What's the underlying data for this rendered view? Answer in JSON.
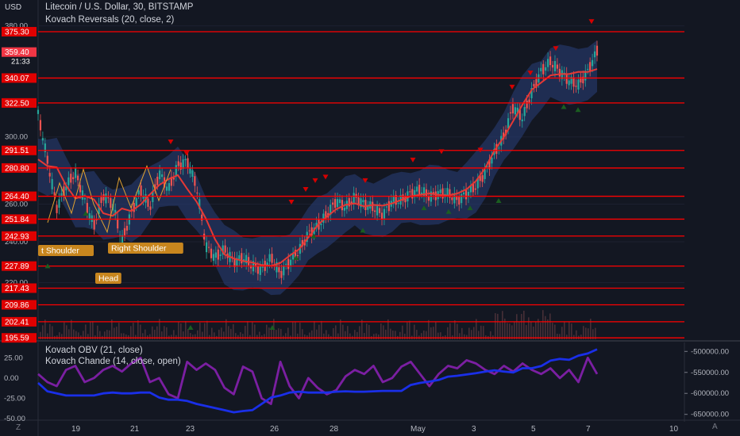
{
  "header": {
    "title": "Litecoin / U.S. Dollar, 30, BITSTAMP",
    "indicator_1": "Kovach Reversals (20, close, 2)",
    "indicator_2": "Kovach OBV (21, close)",
    "indicator_3": "Kovach Chande (14, close, open)",
    "currency": "USD",
    "price_badge": "359.40",
    "countdown": "21:33",
    "logo_text": "Z",
    "tv_logo": "A"
  },
  "colors": {
    "background": "#131722",
    "level_line": "#ff0000",
    "candle_up": "#26a69a",
    "candle_down": "#ef5350",
    "band": "#1e3a8a",
    "band_fill": "#2a3f7a",
    "ma_line": "#e53935",
    "label_bg": "#c8861e",
    "obv_line": "#1a2fe8",
    "chande_line": "#7b1fa2",
    "marker_down": "#d50000",
    "marker_up": "#1b5e20",
    "pattern_line": "#e0a030"
  },
  "chart_data": [
    {
      "type": "line",
      "symbol": "Litecoin / U.S. Dollar, 30, BITSTAMP",
      "x_ticks": [
        "19",
        "21",
        "23",
        "26",
        "28",
        "May",
        "3",
        "5",
        "7",
        "10"
      ],
      "y_ticks": [
        "380.00",
        "300.00",
        "260.00",
        "240.00",
        "220.00"
      ],
      "ylim": [
        195,
        383
      ],
      "scale": "log",
      "price_levels": [
        "375.30",
        "359.40",
        "340.07",
        "322.50",
        "291.51",
        "280.80",
        "264.40",
        "251.84",
        "242.93",
        "227.89",
        "217.43",
        "209.86",
        "202.41",
        "195.59"
      ],
      "support_resistance": [
        375.3,
        340.07,
        322.5,
        291.51,
        280.8,
        264.4,
        251.84,
        242.93,
        227.89,
        217.43,
        209.86,
        202.41,
        195.59
      ],
      "last_price": 359.4,
      "annotations": [
        "t Shoulder",
        "Right Shoulder",
        "Head"
      ],
      "series": [
        {
          "name": "Litecoin / U.S. Dollar",
          "x": [
            0,
            1,
            2,
            3,
            4,
            5,
            6,
            7,
            8,
            9,
            10,
            11,
            12,
            13,
            14,
            15,
            16,
            17,
            18,
            19,
            20,
            21,
            22,
            23,
            24,
            25,
            26,
            27,
            28,
            29,
            30,
            31,
            32,
            33,
            34,
            35,
            36,
            37,
            38,
            39,
            40,
            41,
            42,
            43,
            44,
            45,
            46,
            47,
            48,
            49,
            50,
            51,
            52,
            53,
            54,
            55,
            56,
            57,
            58,
            59,
            60
          ],
          "values": [
            315,
            285,
            258,
            270,
            278,
            262,
            248,
            265,
            260,
            240,
            255,
            268,
            258,
            278,
            268,
            282,
            285,
            270,
            238,
            232,
            236,
            230,
            232,
            228,
            226,
            232,
            224,
            230,
            235,
            244,
            248,
            254,
            262,
            258,
            264,
            260,
            258,
            254,
            262,
            262,
            266,
            268,
            264,
            266,
            266,
            262,
            266,
            270,
            278,
            290,
            300,
            320,
            312,
            330,
            345,
            352,
            345,
            338,
            335,
            345,
            360
          ]
        }
      ]
    },
    {
      "type": "line",
      "title": "Kovach OBV (21, close)",
      "y_ticks": [
        "-500000.00",
        "-550000.00",
        "-600000.00",
        "-650000.00"
      ],
      "ylim": [
        -660000,
        -490000
      ],
      "series": [
        {
          "name": "Kovach OBV (21, close)",
          "x": [
            0,
            1,
            2,
            3,
            4,
            5,
            6,
            7,
            8,
            9,
            10,
            11,
            12,
            13,
            14,
            15,
            16,
            17,
            18,
            19,
            20,
            21,
            22,
            23,
            24,
            25,
            26,
            27,
            28,
            29,
            30,
            31,
            32,
            33,
            34,
            35,
            36,
            37,
            38,
            39,
            40,
            41,
            42,
            43,
            44,
            45,
            46,
            47,
            48,
            49,
            50,
            51,
            52,
            53,
            54,
            55,
            56,
            57,
            58,
            59,
            60
          ],
          "values": [
            -575000,
            -595000,
            -600000,
            -605000,
            -605000,
            -605000,
            -605000,
            -600000,
            -598000,
            -600000,
            -600000,
            -598000,
            -598000,
            -610000,
            -615000,
            -615000,
            -618000,
            -625000,
            -630000,
            -635000,
            -640000,
            -645000,
            -642000,
            -640000,
            -625000,
            -610000,
            -605000,
            -598000,
            -596000,
            -598000,
            -598000,
            -598000,
            -596000,
            -595000,
            -596000,
            -596000,
            -595000,
            -594000,
            -594000,
            -594000,
            -580000,
            -575000,
            -572000,
            -568000,
            -560000,
            -558000,
            -555000,
            -552000,
            -548000,
            -545000,
            -548000,
            -550000,
            -540000,
            -540000,
            -535000,
            -522000,
            -518000,
            -520000,
            -510000,
            -505000,
            -495000
          ]
        }
      ]
    },
    {
      "type": "line",
      "title": "Kovach Chande (14, close, open)",
      "y_ticks": [
        "25.00",
        "0.00",
        "-25.00",
        "-50.00"
      ],
      "ylim": [
        -50,
        38
      ],
      "series": [
        {
          "name": "Kovach Chande (14, close, open)",
          "x": [
            0,
            1,
            2,
            3,
            4,
            5,
            6,
            7,
            8,
            9,
            10,
            11,
            12,
            13,
            14,
            15,
            16,
            17,
            18,
            19,
            20,
            21,
            22,
            23,
            24,
            25,
            26,
            27,
            28,
            29,
            30,
            31,
            32,
            33,
            34,
            35,
            36,
            37,
            38,
            39,
            40,
            41,
            42,
            43,
            44,
            45,
            46,
            47,
            48,
            49,
            50,
            51,
            52,
            53,
            54,
            55,
            56,
            57,
            58,
            59,
            60
          ],
          "values": [
            5,
            -5,
            -10,
            10,
            15,
            -5,
            0,
            10,
            15,
            8,
            18,
            25,
            -5,
            0,
            -20,
            -25,
            20,
            10,
            18,
            10,
            -12,
            -20,
            14,
            8,
            -25,
            -32,
            20,
            -10,
            -25,
            0,
            -12,
            -20,
            -15,
            2,
            10,
            5,
            15,
            -5,
            0,
            14,
            20,
            5,
            -10,
            5,
            15,
            12,
            22,
            18,
            10,
            5,
            15,
            8,
            18,
            10,
            5,
            12,
            0,
            10,
            -5,
            25,
            5
          ]
        }
      ]
    }
  ]
}
